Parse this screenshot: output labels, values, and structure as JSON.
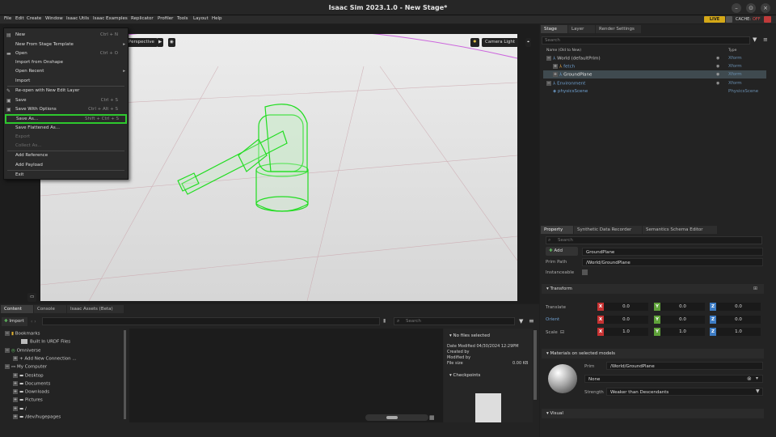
{
  "app": {
    "title": "Isaac Sim 2023.1.0 - New Stage*"
  },
  "window_controls": {
    "minimize": "–",
    "maximize": "⊙",
    "close": "×"
  },
  "menubar": {
    "items": [
      "File",
      "Edit",
      "Create",
      "Window",
      "Isaac Utils",
      "Isaac Examples",
      "Replicator",
      "Profiler",
      "Tools",
      "Layout",
      "Help"
    ]
  },
  "status": {
    "live": "LIVE",
    "cache": "CACHE:",
    "cache_state": "OFF"
  },
  "file_menu": {
    "items": [
      {
        "label": "New",
        "shortcut": "Ctrl + N",
        "icon": "new-file-icon"
      },
      {
        "label": "New From Stage Template",
        "shortcut": "",
        "submenu": true
      },
      {
        "label": "Open",
        "shortcut": "Ctrl + O",
        "icon": "folder-icon"
      },
      {
        "label": "Import from Onshape",
        "shortcut": ""
      },
      {
        "label": "Open Recent",
        "shortcut": "",
        "submenu": true
      },
      {
        "label": "Import",
        "shortcut": ""
      },
      {
        "label": "Re-open with New Edit Layer",
        "shortcut": "",
        "icon": "edit-layer-icon"
      },
      {
        "label": "Save",
        "shortcut": "Ctrl + S",
        "icon": "save-icon"
      },
      {
        "label": "Save With Options",
        "shortcut": "Ctrl + Alt + S",
        "icon": "save-options-icon"
      },
      {
        "label": "Save As...",
        "shortcut": "Shift + Ctrl + S",
        "highlighted": true
      },
      {
        "label": "Save Flattened As...",
        "shortcut": ""
      },
      {
        "label": "Export",
        "shortcut": "",
        "disabled": true
      },
      {
        "label": "Collect As...",
        "shortcut": "",
        "disabled": true
      },
      {
        "label": "Add Reference",
        "shortcut": ""
      },
      {
        "label": "Add Payload",
        "shortcut": ""
      },
      {
        "label": "Exit",
        "shortcut": ""
      }
    ]
  },
  "viewport": {
    "camera": "Perspective",
    "light": "Camera Light"
  },
  "stage": {
    "tabs": [
      "Stage",
      "Layer",
      "Render Settings"
    ],
    "search_placeholder": "Search",
    "col_name": "Name (Old to New)",
    "col_type": "Type",
    "rows": [
      {
        "name": "World (defaultPrim)",
        "type": "Xform"
      },
      {
        "name": "fetch",
        "type": "Xform"
      },
      {
        "name": "GroundPlane",
        "type": "Xform"
      },
      {
        "name": "Environment",
        "type": "Xform"
      },
      {
        "name": "physicsScene",
        "type": "PhysicsScene"
      }
    ]
  },
  "property": {
    "tabs": [
      "Property",
      "Synthetic Data Recorder",
      "Semantics Schema Editor"
    ],
    "search_placeholder": "Search",
    "add_label": "Add",
    "prim_name": "GroundPlane",
    "prim_path_label": "Prim Path",
    "prim_path": "/World/GroundPlane",
    "instanceable_label": "Instanceable",
    "transform_label": "Transform",
    "translate_label": "Translate",
    "orient_label": "Orient",
    "scale_label": "Scale",
    "translate": [
      "0.0",
      "0.0",
      "0.0"
    ],
    "orient": [
      "0.0",
      "0.0",
      "0.0"
    ],
    "scale": [
      "1.0",
      "1.0",
      "1.0"
    ],
    "materials_label": "Materials on selected models",
    "prim_label": "Prim",
    "material_prim": "/World/GroundPlane",
    "material_value": "None",
    "strength_label": "Strength",
    "strength_value": "Weaker than Descendants",
    "visual_label": "Visual"
  },
  "content": {
    "tabs": [
      "Content",
      "Console",
      "Isaac Assets (Beta)"
    ],
    "import_label": "Import",
    "search_placeholder": "Search",
    "tree": [
      {
        "label": "Bookmarks",
        "level": 0
      },
      {
        "label": "Built In URDF Files",
        "level": 1
      },
      {
        "label": "Omniverse",
        "level": 0
      },
      {
        "label": "Add New Connection ...",
        "level": 1
      },
      {
        "label": "My Computer",
        "level": 0
      },
      {
        "label": "Desktop",
        "level": 1
      },
      {
        "label": "Documents",
        "level": 1
      },
      {
        "label": "Downloads",
        "level": 1
      },
      {
        "label": "Pictures",
        "level": 1
      },
      {
        "label": "/",
        "level": 1
      },
      {
        "label": "/dev/hugepages",
        "level": 1
      }
    ],
    "details_title": "No files selected",
    "date_modified": "Date Modified 04/30/2024 12:29PM",
    "created_by": "Created by",
    "modified_by": "Modified by",
    "file_size_label": "File size",
    "file_size": "0.00 KB",
    "checkpoints": "Checkpoints"
  }
}
